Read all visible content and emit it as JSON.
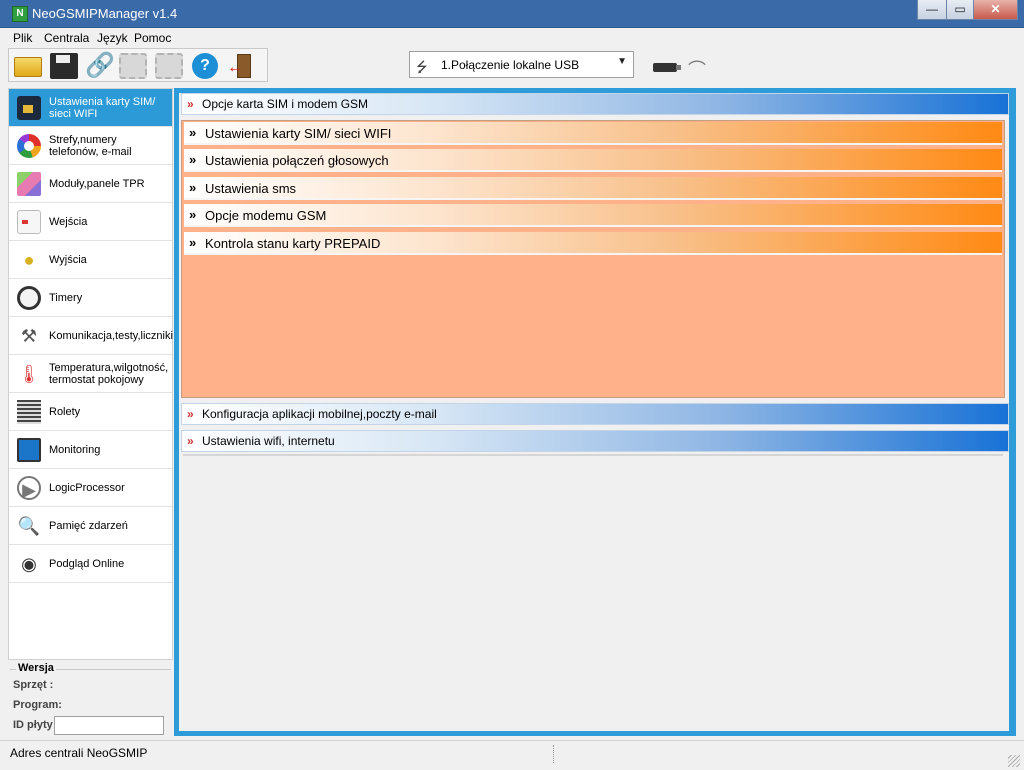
{
  "window": {
    "title": "NeoGSMIPManager v1.4",
    "min": "—",
    "max": "▭",
    "close": "✕"
  },
  "menu": [
    {
      "label": "Plik"
    },
    {
      "label": "Centrala"
    },
    {
      "label": "Język"
    },
    {
      "label": "Pomoc"
    }
  ],
  "toolbar": {
    "icons": [
      "open-folder-icon",
      "save-icon",
      "connect-icon",
      "chip-upload-icon",
      "chip-download-icon",
      "help-icon",
      "exit-icon"
    ],
    "connection_value": "1.Połączenie lokalne USB",
    "connection_icon": "usb-icon"
  },
  "sidebar": {
    "items": [
      {
        "label": "Ustawienia karty SIM/ sieci WIFI",
        "icon": "sim-card-icon",
        "active": true
      },
      {
        "label": "Strefy,numery telefonów, e-mail",
        "icon": "zones-icon"
      },
      {
        "label": "Moduły,panele TPR",
        "icon": "modules-icon"
      },
      {
        "label": "Wejścia",
        "icon": "input-sensor-icon"
      },
      {
        "label": "Wyjścia",
        "icon": "bulb-icon"
      },
      {
        "label": "Timery",
        "icon": "clock-icon"
      },
      {
        "label": "Komunikacja,testy,liczniki",
        "icon": "tools-icon"
      },
      {
        "label": "Temperatura,wilgotność, termostat pokojowy",
        "icon": "thermometer-icon"
      },
      {
        "label": "Rolety",
        "icon": "blinds-icon"
      },
      {
        "label": "Monitoring",
        "icon": "monitor-icon"
      },
      {
        "label": "LogicProcessor",
        "icon": "logic-icon"
      },
      {
        "label": "Pamięć zdarzeń",
        "icon": "event-memory-icon"
      },
      {
        "label": "Podgląd Online",
        "icon": "online-preview-icon"
      }
    ]
  },
  "version": {
    "title": "Wersja",
    "hardware": "Sprzęt :",
    "program": "Program:",
    "board_id": "ID płyty",
    "board_id_value": ""
  },
  "main": {
    "section_sim": {
      "label": "Opcje karta SIM i modem GSM",
      "items": [
        {
          "label": "Ustawienia karty SIM/ sieci WIFI"
        },
        {
          "label": "Ustawienia połączeń głosowych"
        },
        {
          "label": "Ustawienia sms"
        },
        {
          "label": "Opcje modemu GSM"
        },
        {
          "label": "Kontrola stanu karty PREPAID"
        }
      ]
    },
    "section_mobile": {
      "label": "Konfiguracja aplikacji mobilnej,poczty e-mail"
    },
    "section_wifi": {
      "label": "Ustawienia wifi, internetu"
    }
  },
  "statusbar": {
    "text": "Adres centrali NeoGSMIP"
  }
}
